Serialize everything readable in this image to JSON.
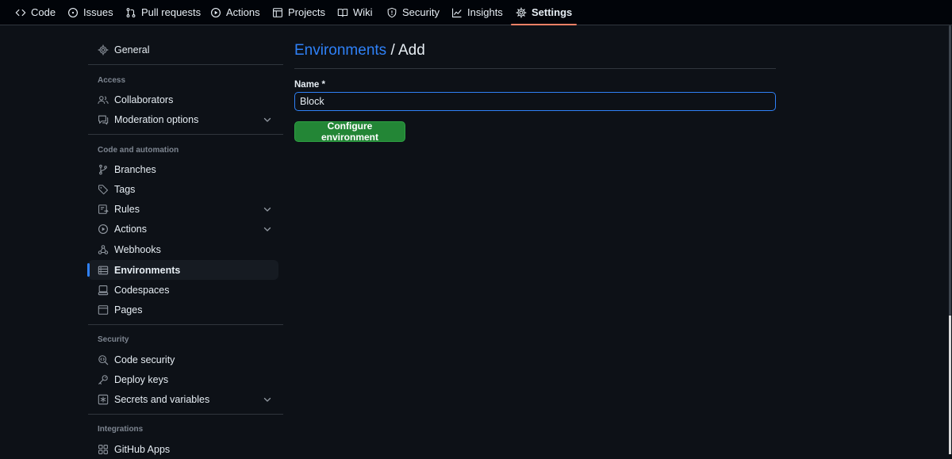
{
  "repo_nav": {
    "tabs": [
      {
        "label": "Code",
        "icon": "code-icon"
      },
      {
        "label": "Issues",
        "icon": "issue-icon"
      },
      {
        "label": "Pull requests",
        "icon": "pull-request-icon"
      },
      {
        "label": "Actions",
        "icon": "play-icon"
      },
      {
        "label": "Projects",
        "icon": "table-icon"
      },
      {
        "label": "Wiki",
        "icon": "book-icon"
      },
      {
        "label": "Security",
        "icon": "shield-icon"
      },
      {
        "label": "Insights",
        "icon": "graph-icon"
      },
      {
        "label": "Settings",
        "icon": "gear-icon"
      }
    ],
    "active": "Settings"
  },
  "sidebar": {
    "general": {
      "label": "General",
      "icon": "gear-icon"
    },
    "sections": [
      {
        "heading": "Access",
        "items": [
          {
            "label": "Collaborators",
            "icon": "people-icon"
          },
          {
            "label": "Moderation options",
            "icon": "comment-icon",
            "expandable": true
          }
        ]
      },
      {
        "heading": "Code and automation",
        "items": [
          {
            "label": "Branches",
            "icon": "branch-icon"
          },
          {
            "label": "Tags",
            "icon": "tag-icon"
          },
          {
            "label": "Rules",
            "icon": "rules-icon",
            "expandable": true
          },
          {
            "label": "Actions",
            "icon": "play-icon",
            "expandable": true
          },
          {
            "label": "Webhooks",
            "icon": "webhook-icon"
          },
          {
            "label": "Environments",
            "icon": "server-icon",
            "selected": true
          },
          {
            "label": "Codespaces",
            "icon": "codespaces-icon"
          },
          {
            "label": "Pages",
            "icon": "browser-icon"
          }
        ]
      },
      {
        "heading": "Security",
        "items": [
          {
            "label": "Code security",
            "icon": "codescan-icon"
          },
          {
            "label": "Deploy keys",
            "icon": "key-icon"
          },
          {
            "label": "Secrets and variables",
            "icon": "asterisk-icon",
            "expandable": true
          }
        ]
      },
      {
        "heading": "Integrations",
        "items": [
          {
            "label": "GitHub Apps",
            "icon": "apps-icon"
          }
        ]
      }
    ]
  },
  "main": {
    "breadcrumb_link": "Environments",
    "breadcrumb_sep": "/",
    "title": "Add",
    "name_label": "Name *",
    "name_value": "Block",
    "submit_label": "Configure environment"
  },
  "colors": {
    "background": "#0d1117",
    "accent": "#2f81f7",
    "button": "#238636",
    "active_tab_underline": "#f78166"
  }
}
